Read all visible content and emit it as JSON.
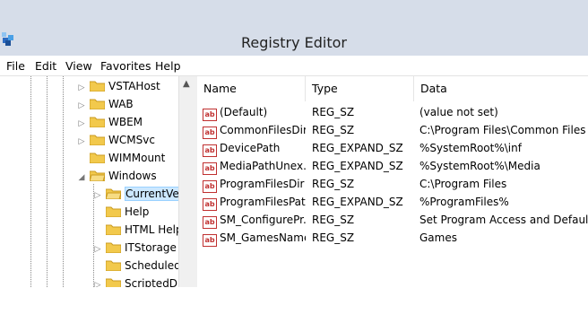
{
  "window": {
    "title": "Registry Editor"
  },
  "menu": [
    "File",
    "Edit",
    "View",
    "Favorites",
    "Help"
  ],
  "tree": {
    "items": [
      {
        "label": "VSTAHost",
        "expander": "▷"
      },
      {
        "label": "WAB",
        "expander": "▷"
      },
      {
        "label": "WBEM",
        "expander": "▷"
      },
      {
        "label": "WCMSvc",
        "expander": "▷"
      },
      {
        "label": "WIMMount",
        "expander": ""
      },
      {
        "label": "Windows",
        "expander": "◢"
      },
      {
        "label": "CurrentVer",
        "expander": "▷",
        "selected": true
      },
      {
        "label": "Help",
        "expander": ""
      },
      {
        "label": "HTML Help",
        "expander": ""
      },
      {
        "label": "ITStorage",
        "expander": "▷"
      },
      {
        "label": "ScheduledI",
        "expander": ""
      },
      {
        "label": "ScriptedDia",
        "expander": "▷"
      }
    ]
  },
  "list": {
    "columns": [
      "Name",
      "Type",
      "Data"
    ],
    "rows": [
      {
        "name": "(Default)",
        "type": "REG_SZ",
        "data": "(value not set)"
      },
      {
        "name": "CommonFilesDir",
        "type": "REG_SZ",
        "data": "C:\\Program Files\\Common Files"
      },
      {
        "name": "DevicePath",
        "type": "REG_EXPAND_SZ",
        "data": "%SystemRoot%\\inf"
      },
      {
        "name": "MediaPathUnex...",
        "type": "REG_EXPAND_SZ",
        "data": "%SystemRoot%\\Media"
      },
      {
        "name": "ProgramFilesDir",
        "type": "REG_SZ",
        "data": "C:\\Program Files"
      },
      {
        "name": "ProgramFilesPath",
        "type": "REG_EXPAND_SZ",
        "data": "%ProgramFiles%"
      },
      {
        "name": "SM_ConfigurePr...",
        "type": "REG_SZ",
        "data": "Set Program Access and Defaults"
      },
      {
        "name": "SM_GamesName",
        "type": "REG_SZ",
        "data": "Games"
      }
    ]
  },
  "icons": {
    "value_icon": "ab",
    "folder_color": "#f2c94c",
    "accent": "#cce8ff"
  }
}
